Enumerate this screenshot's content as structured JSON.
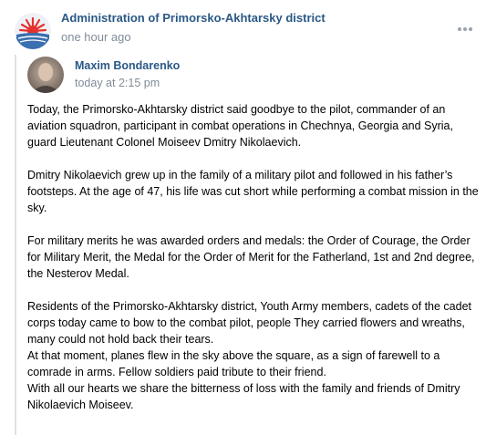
{
  "post": {
    "community_name": "Administration of Primorsko-Akhtarsky district",
    "time": "one hour ago",
    "more_icon": "more-horizontal-icon"
  },
  "repost": {
    "author": "Maxim Bondarenko",
    "time": "today at 2:15 pm",
    "paragraphs": [
      "Today, the Primorsko-Akhtarsky district said goodbye to the pilot, commander of an aviation squadron, participant in combat operations in Chechnya, Georgia and Syria, guard Lieutenant Colonel Moiseev Dmitry Nikolaevich.",
      "Dmitry Nikolaevich grew up in the family of a military pilot and followed in his father’s footsteps. At the age of 47, his life was cut short while performing a combat mission in the sky.",
      "For military merits he was awarded orders and medals: the Order of Courage, the Order for Military Merit, the Medal for the Order of Merit for the Fatherland, 1st and 2nd degree, the Nesterov Medal."
    ],
    "last_paragraph_lines": [
      "Residents of the Primorsko-Akhtarsky district, Youth Army members, cadets of the cadet corps today came to bow to the combat pilot, people They carried flowers and wreaths, many could not hold back their tears.",
      "At that moment, planes flew in the sky above the square, as a sign of farewell to a comrade in arms. Fellow soldiers paid tribute to their friend.",
      "With all our hearts we share the bitterness of loss with the family and friends of Dmitry Nikolaevich Moiseev."
    ]
  },
  "colors": {
    "link": "#2a5885",
    "meta": "#818c99",
    "repost_border": "#dce1e6",
    "logo_red": "#e5312f",
    "logo_sea": "#3a6fb0"
  }
}
